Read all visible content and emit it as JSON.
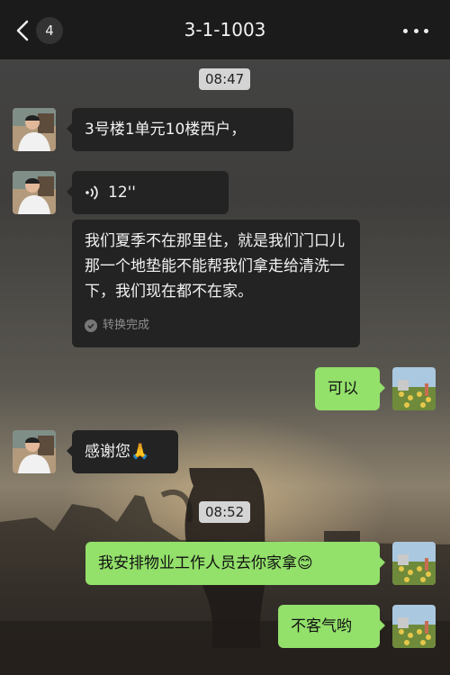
{
  "header": {
    "unread_count": "4",
    "title": "3-1-1003"
  },
  "timestamps": [
    "08:47",
    "08:52"
  ],
  "messages": {
    "m1": {
      "text": "3号楼1单元10楼西户，"
    },
    "m2": {
      "duration": "12''"
    },
    "m3": {
      "text": "我们夏季不在那里住，就是我们门口儿那一个地垫能不能帮我们拿走给清洗一下，我们现在都不在家。",
      "status": "转换完成"
    },
    "m4": {
      "text": "可以"
    },
    "m5": {
      "text": "感谢您🙏"
    },
    "m6": {
      "text": "我安排物业工作人员去你家拿😊"
    },
    "m7": {
      "text": "不客气哟"
    }
  },
  "colors": {
    "header_bg": "#1b1b1b",
    "incoming_bubble": "#232323",
    "outgoing_bubble": "#93e06b",
    "timestamp_bg": "#d4d4d4"
  },
  "icons": [
    "chevron-left-icon",
    "more-dots-icon",
    "voice-wave-icon",
    "check-icon",
    "pray-emoji",
    "smile-emoji"
  ]
}
